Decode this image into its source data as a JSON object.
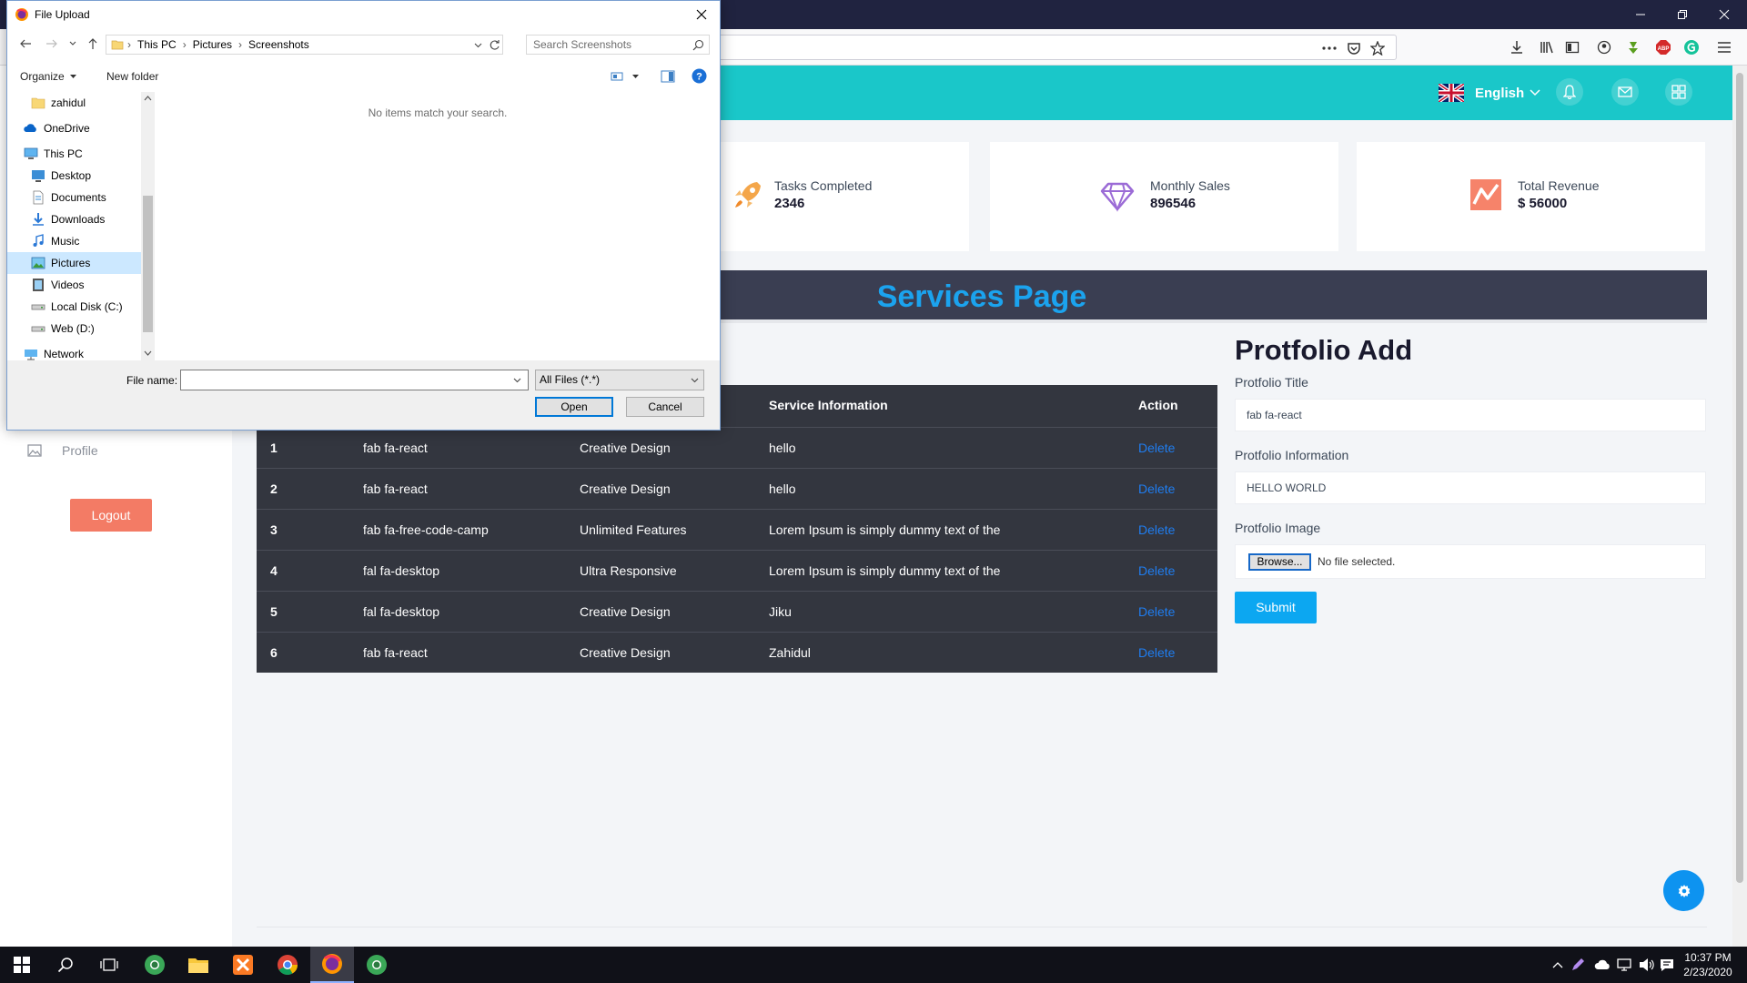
{
  "dialog": {
    "title": "File Upload",
    "path": [
      "This PC",
      "Pictures",
      "Screenshots"
    ],
    "search_placeholder": "Search Screenshots",
    "toolbar": {
      "organize": "Organize",
      "new_folder": "New folder"
    },
    "nav_items": [
      {
        "label": "zahidul",
        "icon": "folder-icon"
      },
      {
        "label": "OneDrive",
        "icon": "onedrive-icon"
      },
      {
        "label": "This PC",
        "icon": "computer-icon"
      },
      {
        "label": "Desktop",
        "icon": "desktop-icon"
      },
      {
        "label": "Documents",
        "icon": "documents-icon"
      },
      {
        "label": "Downloads",
        "icon": "downloads-icon"
      },
      {
        "label": "Music",
        "icon": "music-icon"
      },
      {
        "label": "Pictures",
        "icon": "pictures-icon",
        "selected": true
      },
      {
        "label": "Videos",
        "icon": "videos-icon"
      },
      {
        "label": "Local Disk (C:)",
        "icon": "drive-icon"
      },
      {
        "label": "Web (D:)",
        "icon": "drive-icon"
      },
      {
        "label": "Network",
        "icon": "network-icon"
      }
    ],
    "empty_message": "No items match your search.",
    "file_name_label": "File name:",
    "file_name_value": "",
    "file_type": "All Files (*.*)",
    "open_label": "Open",
    "cancel_label": "Cancel"
  },
  "header": {
    "language": "English"
  },
  "stats": [
    {
      "label": "Tasks Completed",
      "value": "2346",
      "icon": "rocket-icon"
    },
    {
      "label": "Monthly Sales",
      "value": "896546",
      "icon": "diamond-icon"
    },
    {
      "label": "Total Revenue",
      "value": "$ 56000",
      "icon": "chart-icon"
    }
  ],
  "services": {
    "title": "Services Page",
    "columns": {
      "info": "Service Information",
      "action": "Action"
    },
    "rows": [
      {
        "num": "1",
        "icon": "fab fa-react",
        "title": "Creative Design",
        "info": "hello",
        "action": "Delete"
      },
      {
        "num": "2",
        "icon": "fab fa-react",
        "title": "Creative Design",
        "info": "hello",
        "action": "Delete"
      },
      {
        "num": "3",
        "icon": "fab fa-free-code-camp",
        "title": "Unlimited Features",
        "info": "Lorem Ipsum is simply dummy text of the",
        "action": "Delete"
      },
      {
        "num": "4",
        "icon": "fal fa-desktop",
        "title": "Ultra Responsive",
        "info": "Lorem Ipsum is simply dummy text of the",
        "action": "Delete"
      },
      {
        "num": "5",
        "icon": "fal fa-desktop",
        "title": "Creative Design",
        "info": "Jiku",
        "action": "Delete"
      },
      {
        "num": "6",
        "icon": "fab fa-react",
        "title": "Creative Design",
        "info": "Zahidul",
        "action": "Delete"
      }
    ]
  },
  "portfolio_form": {
    "title": "Protfolio Add",
    "title_label": "Protfolio Title",
    "title_value": "fab fa-react",
    "info_label": "Protfolio Information",
    "info_value": "HELLO WORLD",
    "image_label": "Protfolio Image",
    "browse_label": "Browse...",
    "no_file": "No file selected.",
    "submit_label": "Submit"
  },
  "sidebar": {
    "profile_label": "Profile",
    "logout_label": "Logout"
  },
  "taskbar": {
    "time": "10:37 PM",
    "date": "2/23/2020"
  },
  "colors": {
    "accent": "#1ac7c9",
    "title_blue": "#1ba3ee",
    "logout": "#f37b65",
    "submit": "#0ca7f1",
    "table_bg": "#33363f"
  }
}
